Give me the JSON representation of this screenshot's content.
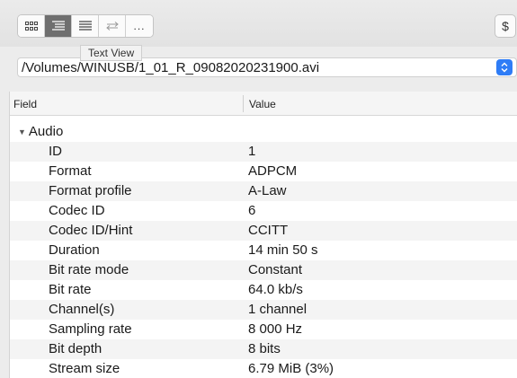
{
  "toolbar": {
    "view_buttons": [
      {
        "icon": "grid-view-icon",
        "active": false
      },
      {
        "icon": "tree-view-icon",
        "active": true
      },
      {
        "icon": "text-view-icon",
        "active": false
      },
      {
        "icon": "compare-icon",
        "active": false
      },
      {
        "icon": "more-icon",
        "label": "..."
      }
    ],
    "tooltip": "Text View",
    "dollar_label": "$"
  },
  "file": {
    "path": "/Volumes/WINUSB/1_01_R_09082020231900.avi"
  },
  "table": {
    "headers": {
      "field": "Field",
      "value": "Value"
    },
    "section": "Audio",
    "rows": [
      {
        "field": "ID",
        "value": "1"
      },
      {
        "field": "Format",
        "value": "ADPCM"
      },
      {
        "field": "Format profile",
        "value": "A-Law"
      },
      {
        "field": "Codec ID",
        "value": "6"
      },
      {
        "field": "Codec ID/Hint",
        "value": "CCITT"
      },
      {
        "field": "Duration",
        "value": "14 min 50 s"
      },
      {
        "field": "Bit rate mode",
        "value": "Constant"
      },
      {
        "field": "Bit rate",
        "value": "64.0 kb/s"
      },
      {
        "field": "Channel(s)",
        "value": "1 channel"
      },
      {
        "field": "Sampling rate",
        "value": "8 000 Hz"
      },
      {
        "field": "Bit depth",
        "value": "8 bits"
      },
      {
        "field": "Stream size",
        "value": "6.79 MiB (3%)"
      }
    ]
  },
  "colors": {
    "accent": "#2e7cf6",
    "active_button": "#6f6f6f"
  }
}
